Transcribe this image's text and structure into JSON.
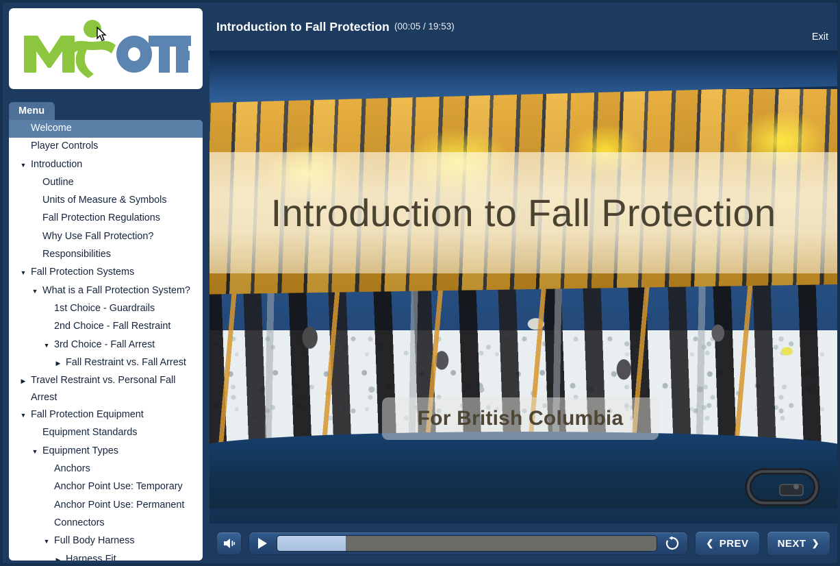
{
  "window": {
    "frame_color": "#16304f",
    "body_color": "#1d3a5f"
  },
  "sidebar": {
    "logo": {
      "name": "myotf-logo",
      "text_green": "MY",
      "text_blue": "OTF",
      "green": "#8CC63F",
      "blue": "#5B84B1"
    },
    "menu_tab_label": "Menu",
    "selected_item": "Welcome",
    "items": [
      {
        "label": "Welcome",
        "level": 0,
        "toggle": "none",
        "selected": true
      },
      {
        "label": "Player Controls",
        "level": 0,
        "toggle": "none",
        "selected": false
      },
      {
        "label": "Introduction",
        "level": 0,
        "toggle": "expanded",
        "selected": false
      },
      {
        "label": "Outline",
        "level": 1,
        "toggle": "none",
        "selected": false
      },
      {
        "label": "Units of Measure & Symbols",
        "level": 1,
        "toggle": "none",
        "selected": false
      },
      {
        "label": "Fall Protection Regulations",
        "level": 1,
        "toggle": "none",
        "selected": false
      },
      {
        "label": "Why Use Fall Protection?",
        "level": 1,
        "toggle": "none",
        "selected": false
      },
      {
        "label": "Responsibilities",
        "level": 1,
        "toggle": "none",
        "selected": false
      },
      {
        "label": "Fall Protection Systems",
        "level": 0,
        "toggle": "expanded",
        "selected": false
      },
      {
        "label": "What is a Fall Protection System?",
        "level": 1,
        "toggle": "expanded",
        "selected": false
      },
      {
        "label": "1st Choice - Guardrails",
        "level": 2,
        "toggle": "none",
        "selected": false
      },
      {
        "label": "2nd Choice - Fall Restraint",
        "level": 2,
        "toggle": "none",
        "selected": false
      },
      {
        "label": "3rd Choice - Fall Arrest",
        "level": 2,
        "toggle": "expanded",
        "selected": false
      },
      {
        "label": "Fall Restraint vs. Fall Arrest",
        "level": 3,
        "toggle": "collapsed",
        "selected": false
      },
      {
        "label": "Travel Restraint vs. Personal Fall Arrest",
        "level": 0,
        "toggle": "collapsed",
        "selected": false
      },
      {
        "label": "Fall Protection Equipment",
        "level": 0,
        "toggle": "expanded",
        "selected": false
      },
      {
        "label": "Equipment Standards",
        "level": 1,
        "toggle": "none",
        "selected": false
      },
      {
        "label": "Equipment Types",
        "level": 1,
        "toggle": "expanded",
        "selected": false
      },
      {
        "label": "Anchors",
        "level": 2,
        "toggle": "none",
        "selected": false
      },
      {
        "label": "Anchor Point Use: Temporary",
        "level": 2,
        "toggle": "none",
        "selected": false
      },
      {
        "label": "Anchor Point Use: Permanent",
        "level": 2,
        "toggle": "none",
        "selected": false
      },
      {
        "label": "Connectors",
        "level": 2,
        "toggle": "none",
        "selected": false
      },
      {
        "label": "Full Body Harness",
        "level": 2,
        "toggle": "expanded",
        "selected": false
      },
      {
        "label": "Harness Fit",
        "level": 3,
        "toggle": "collapsed",
        "selected": false
      }
    ]
  },
  "header": {
    "title": "Introduction to Fall Protection",
    "time": "(00:05 / 19:53)",
    "elapsed": "00:05",
    "duration": "19:53",
    "exit_label": "Exit"
  },
  "slide": {
    "title": "Introduction to Fall Protection",
    "subtitle": "For British Columbia",
    "title_color": "#4b4332",
    "banner_tint": "#fffaE8"
  },
  "player": {
    "volume_icon": "speaker-icon",
    "play_icon": "play-icon",
    "replay_icon": "replay-icon",
    "progress_percent": 18,
    "prev_label": "PREV",
    "next_label": "NEXT",
    "prev_chevron": "❮",
    "next_chevron": "❯"
  }
}
